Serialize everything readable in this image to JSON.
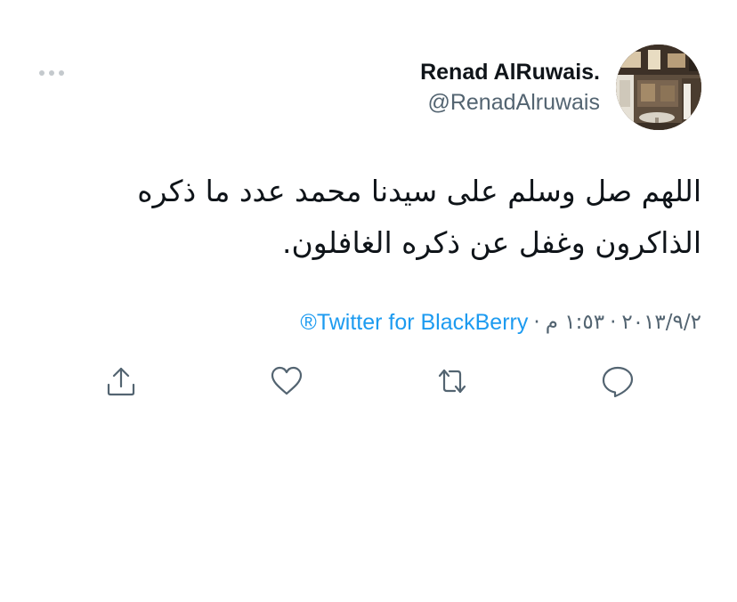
{
  "tweet": {
    "author": {
      "display_name": "Renad AlRuwais.",
      "handle": "@RenadAlruwais"
    },
    "text": "اللهم صل وسلم على سيدنا محمد عدد ما ذكره\nالذاكرون وغفل عن ذكره الغافلون.",
    "meta": {
      "date": "٢٠١٣/٩/٢",
      "time": "١:٥٣ م",
      "separator": "·",
      "source": "Twitter for BlackBerry®"
    }
  },
  "icons": {
    "more": "more-horizontal-icon",
    "reply": "reply-icon",
    "retweet": "retweet-icon",
    "like": "heart-icon",
    "share": "share-icon"
  },
  "colors": {
    "text": "#0f1419",
    "secondary": "#536471",
    "link": "#1d9bf0",
    "muted_dots": "#c4c9cd"
  }
}
